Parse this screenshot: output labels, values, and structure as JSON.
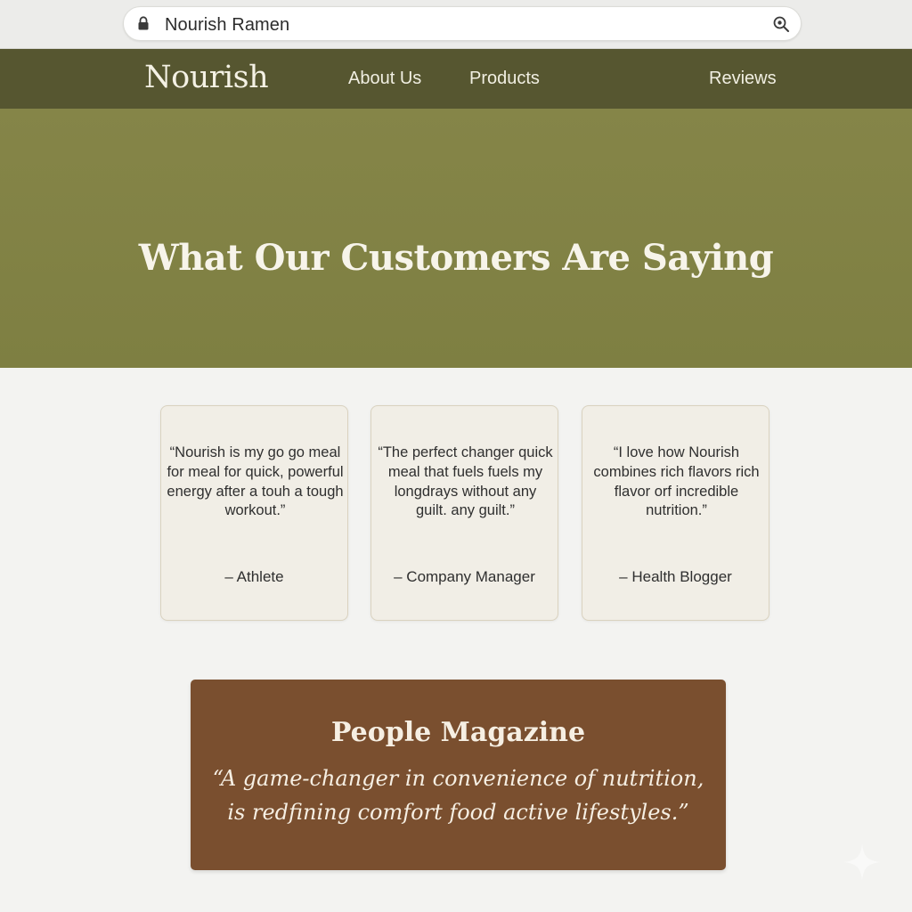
{
  "browser": {
    "url_text": "Nourish Ramen",
    "icons": [
      "lock-icon",
      "zoom-icon"
    ]
  },
  "nav": {
    "logo": "Nourish",
    "links": [
      "About Us",
      "Products",
      "Reviews"
    ]
  },
  "hero": {
    "title": "What Our Customers Are Saying"
  },
  "testimonials": [
    {
      "quote": "“Nourish is my go go meal for meal for quick, powerful energy after a touh a tough workout.”",
      "author": "– Athlete"
    },
    {
      "quote": "“The perfect changer quick meal that fuels fuels my longdrays without any guilt. any guilt.”",
      "author": "– Company Manager"
    },
    {
      "quote": "“I love how Nourish combines rich flavors rich flavor orf incredible nutrition.”",
      "author": "– Health Blogger"
    }
  ],
  "press": {
    "source": "People Magazine",
    "quote": "“A game-changer in convenience of nutrition, is redfining comfort food active lifestyles.”"
  },
  "colors": {
    "nav_bg": "#565630",
    "hero_bg": "#808143",
    "card_bg": "#f1eee6",
    "press_bg": "#7a4f2f",
    "page_bg": "#f3f3f1"
  }
}
